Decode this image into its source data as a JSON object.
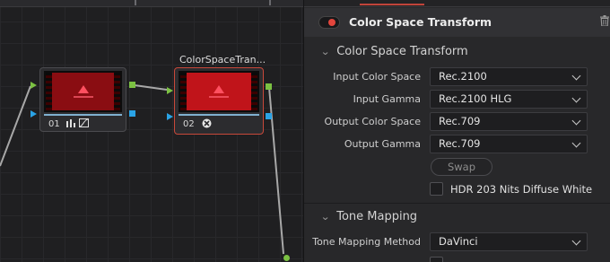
{
  "node_graph": {
    "nodes": [
      {
        "number": "01",
        "icons": [
          "bars-icon",
          "curve-icon"
        ],
        "title": ""
      },
      {
        "number": "02",
        "icons": [
          "fx-icon"
        ],
        "title": "ColorSpaceTran..."
      }
    ],
    "colors": {
      "rgb_port": "#7bc142",
      "alpha_port": "#2aa3e6",
      "selected_outline": "#c8483a"
    }
  },
  "inspector": {
    "effect_title": "Color Space Transform",
    "delete_icon": "trash-icon",
    "enabled": true,
    "sections": {
      "cst": {
        "label": "Color Space Transform",
        "expanded": true,
        "fields": [
          {
            "label": "Input Color Space",
            "value": "Rec.2100"
          },
          {
            "label": "Input Gamma",
            "value": "Rec.2100 HLG"
          },
          {
            "label": "Output Color Space",
            "value": "Rec.709"
          },
          {
            "label": "Output Gamma",
            "value": "Rec.709"
          }
        ],
        "swap_label": "Swap",
        "hdr_checkbox": {
          "label": "HDR 203 Nits Diffuse White",
          "checked": false
        }
      },
      "tone": {
        "label": "Tone Mapping",
        "expanded": true,
        "method_label": "Tone Mapping Method",
        "method_value": "DaVinci"
      }
    },
    "colors": {
      "toggle_dot": "#e2453c",
      "accent_tab": "#c0443a"
    }
  }
}
